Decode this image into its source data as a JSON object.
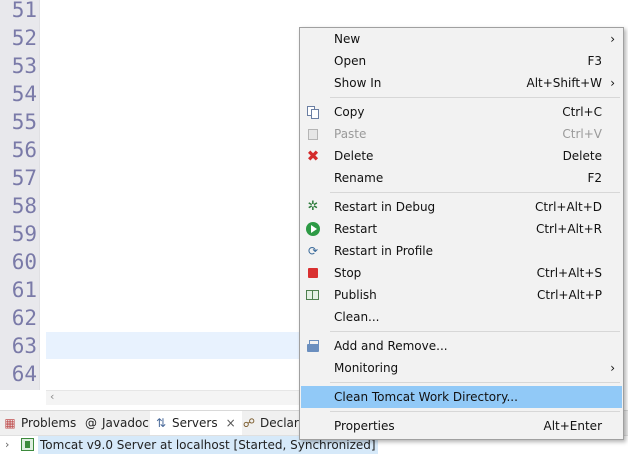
{
  "editor": {
    "line_numbers": [
      "51",
      "52",
      "53",
      "54",
      "55",
      "56",
      "57",
      "58",
      "59",
      "60",
      "61",
      "62",
      "63",
      "64"
    ],
    "hscroll_arrow": "‹"
  },
  "bottom_tabs": [
    {
      "label": "Problems",
      "icon": "problems-icon"
    },
    {
      "label": "Javadoc",
      "icon": "@"
    },
    {
      "label": "Servers",
      "icon": "servers-icon",
      "active": true,
      "close": "×"
    },
    {
      "label": "Declara",
      "icon": "declaration-icon"
    }
  ],
  "servers": {
    "row_label": "Tomcat v9.0 Server at localhost  [Started, Synchronized]"
  },
  "context_menu": {
    "items": [
      {
        "label": "New",
        "shortcut": "",
        "submenu": "›"
      },
      {
        "label": "Open",
        "shortcut": "F3"
      },
      {
        "label": "Show In",
        "shortcut": "Alt+Shift+W",
        "submenu": "›"
      },
      {
        "label": "Copy",
        "shortcut": "Ctrl+C",
        "icon": "copy-icon"
      },
      {
        "label": "Paste",
        "shortcut": "Ctrl+V",
        "icon": "paste-icon",
        "disabled": true
      },
      {
        "label": "Delete",
        "shortcut": "Delete",
        "icon": "delete-icon",
        "glyph": "✖"
      },
      {
        "label": "Rename",
        "shortcut": "F2"
      },
      {
        "label": "Restart in Debug",
        "shortcut": "Ctrl+Alt+D",
        "icon": "debug-icon",
        "glyph": "✲"
      },
      {
        "label": "Restart",
        "shortcut": "Ctrl+Alt+R",
        "icon": "restart-icon"
      },
      {
        "label": "Restart in Profile",
        "shortcut": "",
        "icon": "profile-icon",
        "glyph": "⟳"
      },
      {
        "label": "Stop",
        "shortcut": "Ctrl+Alt+S",
        "icon": "stop-icon"
      },
      {
        "label": "Publish",
        "shortcut": "Ctrl+Alt+P",
        "icon": "publish-icon"
      },
      {
        "label": "Clean...",
        "shortcut": ""
      },
      {
        "label": "Add and Remove...",
        "shortcut": "",
        "icon": "add-remove-icon"
      },
      {
        "label": "Monitoring",
        "shortcut": "",
        "submenu": "›"
      },
      {
        "label": "Clean Tomcat Work Directory...",
        "shortcut": "",
        "highlighted": true
      },
      {
        "label": "Properties",
        "shortcut": "Alt+Enter"
      }
    ]
  },
  "colors": {
    "menu_highlight": "#91c9f7",
    "current_line": "#e8f2fe",
    "line_number": "#7a7aa8",
    "selection": "#d6e9f9"
  }
}
